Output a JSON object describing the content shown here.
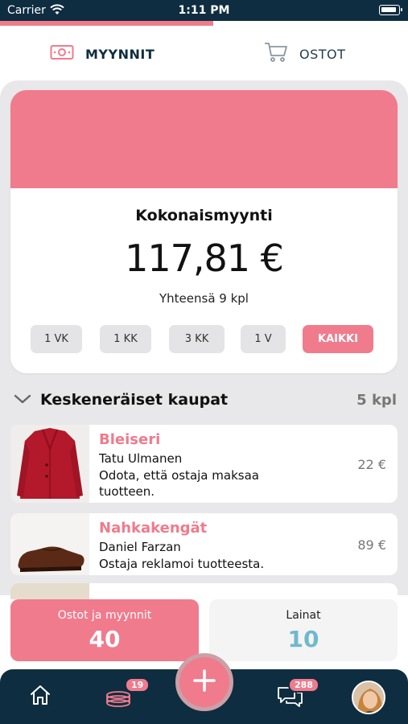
{
  "status_bar": {
    "carrier": "Carrier",
    "time": "1:11 PM"
  },
  "top_tabs": [
    {
      "label": "MYYNNIT",
      "icon": "banknote-icon",
      "active": true
    },
    {
      "label": "OSTOT",
      "icon": "cart-icon",
      "active": false
    }
  ],
  "summary": {
    "title": "Kokonaismyynti",
    "amount": "117,81 €",
    "count": "Yhteensä 9 kpl",
    "filters": [
      "1 VK",
      "1 KK",
      "3 KK",
      "1 V",
      "KAIKKI"
    ],
    "active_filter": "KAIKKI"
  },
  "section": {
    "label": "Keskeneräiset kaupat",
    "count": "5 kpl"
  },
  "deals": [
    {
      "name": "Bleiseri",
      "person": "Tatu Ulmanen",
      "status": "Odota, että ostaja maksaa tuotteen.",
      "price": "22 €"
    },
    {
      "name": "Nahkakengät",
      "person": "Daniel Farzan",
      "status": "Ostaja reklamoi tuotteesta.",
      "price": "89 €"
    }
  ],
  "stats": {
    "left": {
      "label": "Ostot ja myynnit",
      "value": "40"
    },
    "right": {
      "label": "Lainat",
      "value": "10"
    }
  },
  "tabbar": {
    "coins_badge": "19",
    "messages_badge": "288"
  },
  "colors": {
    "accent": "#f07b8c",
    "navy": "#0f2d40",
    "teal": "#6fb9cc"
  }
}
